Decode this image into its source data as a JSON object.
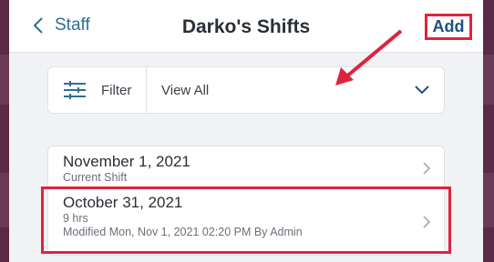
{
  "header": {
    "back_label": "Staff",
    "title": "Darko's Shifts",
    "add_label": "Add"
  },
  "filter": {
    "button_label": "Filter",
    "selected_value": "View All"
  },
  "shifts": [
    {
      "date": "November 1, 2021",
      "subtitle": "Current Shift"
    },
    {
      "date": "October 31, 2021",
      "hours": "9 hrs",
      "modified": "Modified Mon, Nov 1, 2021 02:20 PM By Admin"
    }
  ],
  "colors": {
    "accent": "#2f6f91",
    "add_text": "#1e4f82",
    "annotation": "#e0233c",
    "backdrop": "#5a2a46"
  },
  "icons": [
    "chevron-left-icon",
    "sliders-icon",
    "chevron-down-icon",
    "chevron-right-icon",
    "annotation-arrow"
  ]
}
